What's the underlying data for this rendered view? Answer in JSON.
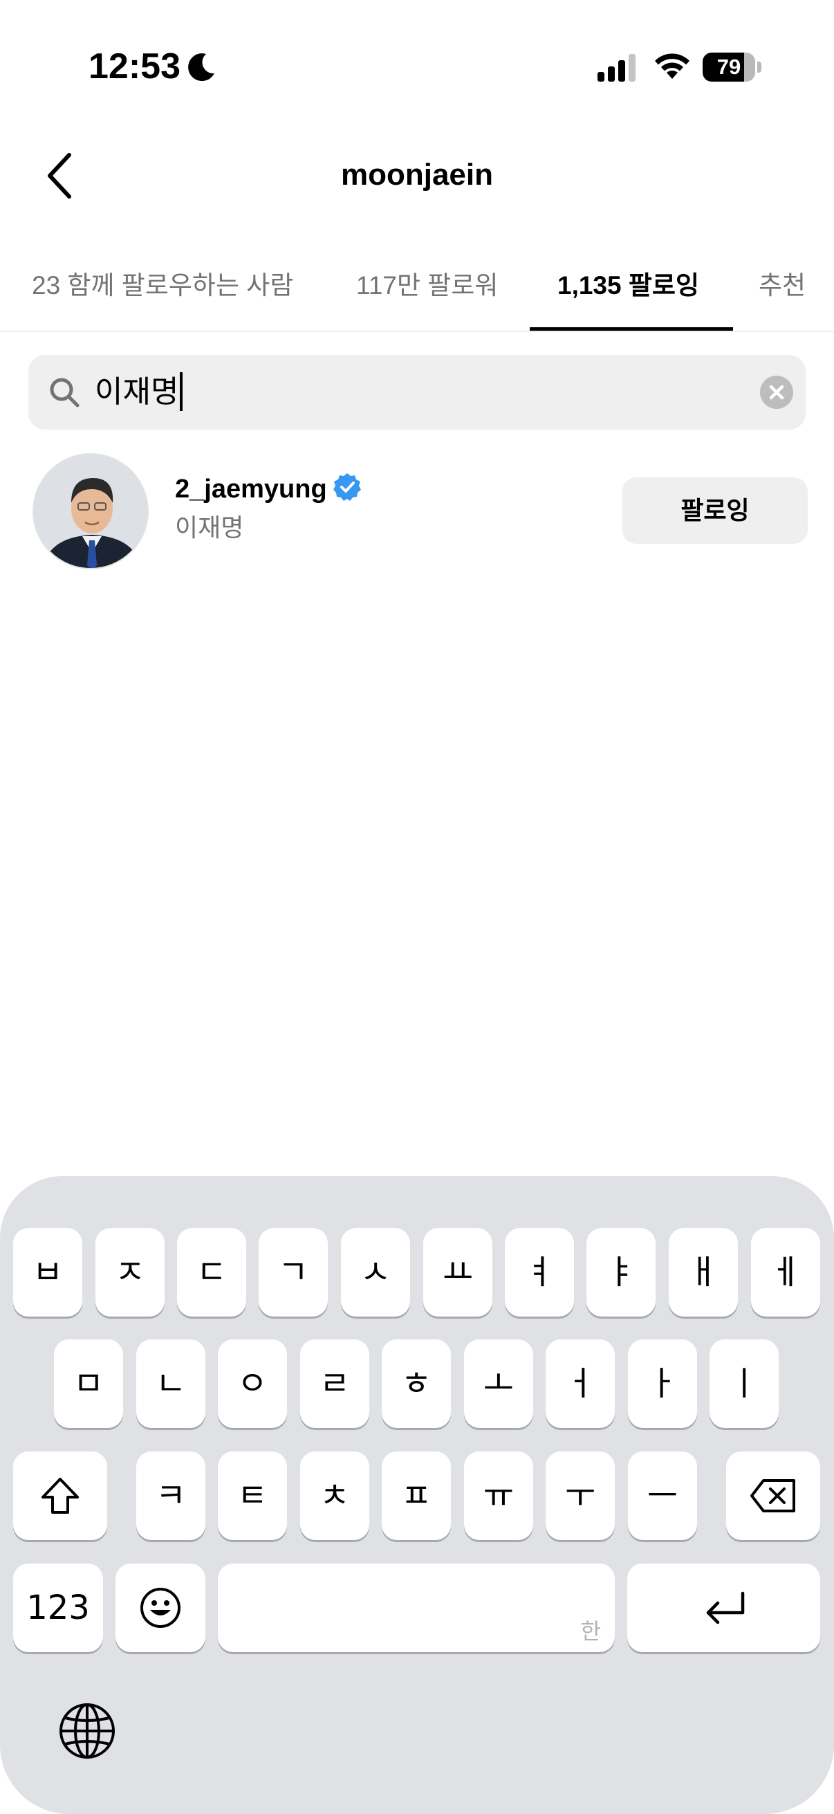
{
  "status_bar": {
    "time": "12:53",
    "battery_level": "79",
    "battery_fraction": 0.79
  },
  "header": {
    "title": "moonjaein"
  },
  "tabs": [
    {
      "label": "23 함께 팔로우하는 사람",
      "active": false
    },
    {
      "label": "117만 팔로워",
      "active": false
    },
    {
      "label": "1,135 팔로잉",
      "active": true
    },
    {
      "label": "추천",
      "active": false
    }
  ],
  "search": {
    "value": "이재명"
  },
  "results": [
    {
      "username": "2_jaemyung",
      "full_name": "이재명",
      "verified": true,
      "button_label": "팔로잉"
    }
  ],
  "keyboard": {
    "row1": [
      "ㅂ",
      "ㅈ",
      "ㄷ",
      "ㄱ",
      "ㅅ",
      "ㅛ",
      "ㅕ",
      "ㅑ",
      "ㅐ",
      "ㅔ"
    ],
    "row2": [
      "ㅁ",
      "ㄴ",
      "ㅇ",
      "ㄹ",
      "ㅎ",
      "ㅗ",
      "ㅓ",
      "ㅏ",
      "ㅣ"
    ],
    "row3": [
      "ㅋ",
      "ㅌ",
      "ㅊ",
      "ㅍ",
      "ㅠ",
      "ㅜ",
      "ㅡ"
    ],
    "numbers_label": "123",
    "space_hint": "한"
  },
  "colors": {
    "accent_verified": "#3897f0",
    "keyboard_bg": "#e0e1e5",
    "secondary_text": "#737373"
  }
}
